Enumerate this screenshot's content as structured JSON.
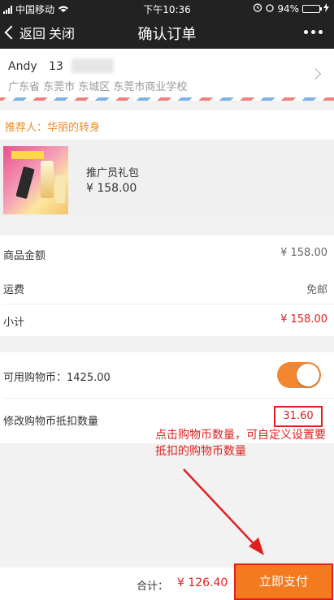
{
  "status_bar": {
    "carrier": "中国移动",
    "time": "下午10:36",
    "battery": "94%",
    "battery_level": 0.94
  },
  "nav": {
    "back_label": "返回",
    "close_label": "关闭",
    "title": "确认订单"
  },
  "address": {
    "name": "Andy",
    "phone_visible": "13",
    "line": "广东省 东莞市 东城区 东莞市商业学校"
  },
  "referrer": {
    "text": "推荐人：华丽的转身"
  },
  "product": {
    "name": "推广员礼包",
    "price": "¥ 158.00"
  },
  "summary": {
    "goods_label": "商品金额",
    "goods_value": "¥ 158.00",
    "shipping_label": "运费",
    "shipping_value": "免邮",
    "subtotal_label": "小计",
    "subtotal_value": "¥ 158.00"
  },
  "coins": {
    "available_label": "可用购物币：1425.00",
    "toggle_on": true,
    "edit_label": "修改购物币抵扣数量",
    "edit_value": "31.60"
  },
  "annotation": {
    "text": "点击购物币数量，可自定义设置要抵扣的购物币数量"
  },
  "footer": {
    "total_label": "合计：",
    "total_value": "¥ 126.40",
    "pay_label": "立即支付"
  },
  "colors": {
    "accent_orange": "#f47a20",
    "price_red": "#e02020",
    "referrer_orange": "#f08a24",
    "toggle_on": "#f38630"
  }
}
